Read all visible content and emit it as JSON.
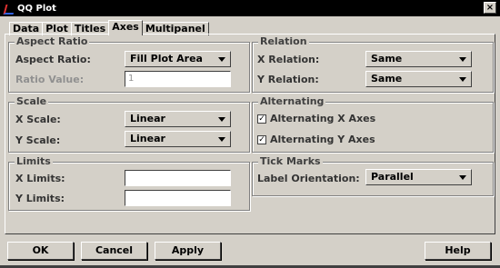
{
  "window": {
    "title": "QQ Plot",
    "close_glyph": "×"
  },
  "tabs": [
    {
      "label": "Data"
    },
    {
      "label": "Plot"
    },
    {
      "label": "Titles"
    },
    {
      "label": "Axes",
      "active": true
    },
    {
      "label": "Multipanel"
    }
  ],
  "aspect_ratio": {
    "group_label": "Aspect Ratio",
    "aspect_label": "Aspect Ratio:",
    "aspect_value": "Fill Plot Area",
    "ratio_label": "Ratio Value:",
    "ratio_value": "1"
  },
  "scale": {
    "group_label": "Scale",
    "x_label": "X Scale:",
    "x_value": "Linear",
    "y_label": "Y Scale:",
    "y_value": "Linear"
  },
  "limits": {
    "group_label": "Limits",
    "x_label": "X Limits:",
    "x_value": "",
    "y_label": "Y Limits:",
    "y_value": ""
  },
  "relation": {
    "group_label": "Relation",
    "x_label": "X Relation:",
    "x_value": "Same",
    "y_label": "Y Relation:",
    "y_value": "Same"
  },
  "alternating": {
    "group_label": "Alternating",
    "x_label": "Alternating X Axes",
    "x_checked": "✓",
    "y_label": "Alternating Y Axes",
    "y_checked": "✓"
  },
  "tick_marks": {
    "group_label": "Tick Marks",
    "orientation_label": "Label Orientation:",
    "orientation_value": "Parallel"
  },
  "buttons": {
    "ok": "OK",
    "cancel": "Cancel",
    "apply": "Apply",
    "help": "Help"
  },
  "colors": {
    "titlebar": "#000000",
    "dialog": "#d4d0c8"
  }
}
